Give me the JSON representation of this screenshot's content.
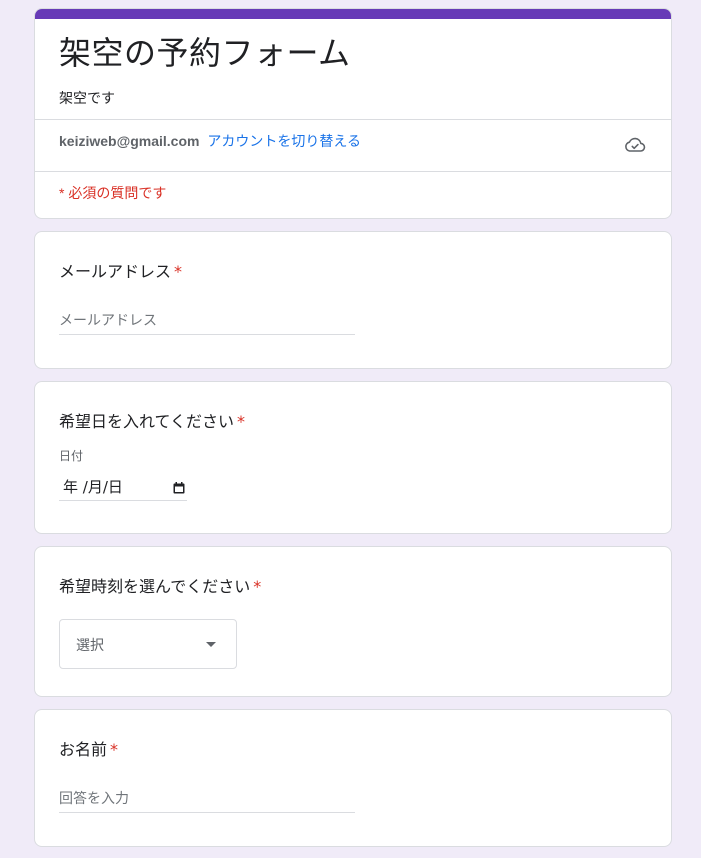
{
  "header": {
    "title": "架空の予約フォーム",
    "description": "架空です",
    "account_email": "keiziweb@gmail.com",
    "switch_account_label": "アカウントを切り替える",
    "required_note": "* 必須の質問です",
    "accent_color": "#673ab7",
    "save_status_icon": "cloud-check-icon"
  },
  "questions": {
    "email": {
      "title": "メールアドレス",
      "required_mark": "*",
      "placeholder": "メールアドレス"
    },
    "date": {
      "title": "希望日を入れてください",
      "required_mark": "*",
      "sub_label": "日付",
      "value_display": "年 /月/日",
      "icon": "calendar-icon"
    },
    "time": {
      "title": "希望時刻を選んでください",
      "required_mark": "*",
      "select_placeholder": "選択",
      "icon": "dropdown-arrow-icon"
    },
    "name": {
      "title": "お名前",
      "required_mark": "*",
      "placeholder": "回答を入力"
    }
  }
}
